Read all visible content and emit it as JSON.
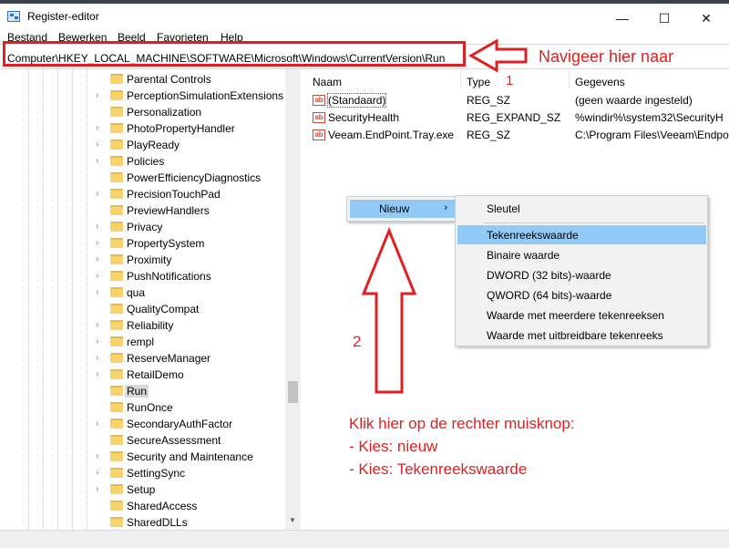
{
  "window": {
    "title": "Register-editor",
    "controls": {
      "minimize": "—",
      "maximize": "☐",
      "close": "✕"
    }
  },
  "menu": [
    "Bestand",
    "Bewerken",
    "Beeld",
    "Favorieten",
    "Help"
  ],
  "address": "Computer\\HKEY_LOCAL_MACHINE\\SOFTWARE\\Microsoft\\Windows\\CurrentVersion\\Run",
  "tree": {
    "items": [
      {
        "label": "Parental Controls",
        "expandable": false
      },
      {
        "label": "PerceptionSimulationExtensions",
        "expandable": true
      },
      {
        "label": "Personalization",
        "expandable": false
      },
      {
        "label": "PhotoPropertyHandler",
        "expandable": true
      },
      {
        "label": "PlayReady",
        "expandable": true
      },
      {
        "label": "Policies",
        "expandable": true
      },
      {
        "label": "PowerEfficiencyDiagnostics",
        "expandable": false
      },
      {
        "label": "PrecisionTouchPad",
        "expandable": true
      },
      {
        "label": "PreviewHandlers",
        "expandable": false
      },
      {
        "label": "Privacy",
        "expandable": true
      },
      {
        "label": "PropertySystem",
        "expandable": true
      },
      {
        "label": "Proximity",
        "expandable": true
      },
      {
        "label": "PushNotifications",
        "expandable": true
      },
      {
        "label": "qua",
        "expandable": true
      },
      {
        "label": "QualityCompat",
        "expandable": false
      },
      {
        "label": "Reliability",
        "expandable": true
      },
      {
        "label": "rempl",
        "expandable": true
      },
      {
        "label": "ReserveManager",
        "expandable": true
      },
      {
        "label": "RetailDemo",
        "expandable": true
      },
      {
        "label": "Run",
        "expandable": false,
        "selected": true
      },
      {
        "label": "RunOnce",
        "expandable": false
      },
      {
        "label": "SecondaryAuthFactor",
        "expandable": true
      },
      {
        "label": "SecureAssessment",
        "expandable": false
      },
      {
        "label": "Security and Maintenance",
        "expandable": true
      },
      {
        "label": "SettingSync",
        "expandable": true
      },
      {
        "label": "Setup",
        "expandable": true
      },
      {
        "label": "SharedAccess",
        "expandable": false
      },
      {
        "label": "SharedDLLs",
        "expandable": false
      }
    ]
  },
  "list": {
    "columns": [
      "Naam",
      "Type",
      "Gegevens"
    ],
    "rows": [
      {
        "name": "(Standaard)",
        "type": "REG_SZ",
        "data": "(geen waarde ingesteld)"
      },
      {
        "name": "SecurityHealth",
        "type": "REG_EXPAND_SZ",
        "data": "%windir%\\system32\\SecurityH"
      },
      {
        "name": "Veeam.EndPoint.Tray.exe",
        "type": "REG_SZ",
        "data": "C:\\Program Files\\Veeam\\Endpo"
      }
    ]
  },
  "context_menu": {
    "new_label": "Nieuw",
    "arrow": "›",
    "submenu": [
      "Sleutel",
      "Tekenreekswaarde",
      "Binaire waarde",
      "DWORD (32 bits)-waarde",
      "QWORD (64 bits)-waarde",
      "Waarde met meerdere tekenreeksen",
      "Waarde met uitbreidbare tekenreeks"
    ],
    "highlighted": "Tekenreekswaarde"
  },
  "annotations": {
    "navigate": "Navigeer hier naar",
    "step1": "1",
    "step2": "2",
    "instructions": [
      "Klik hier op de rechter muisknop:",
      "- Kies: nieuw",
      "- Kies: Tekenreekswaarde"
    ],
    "color": "#e02020"
  }
}
